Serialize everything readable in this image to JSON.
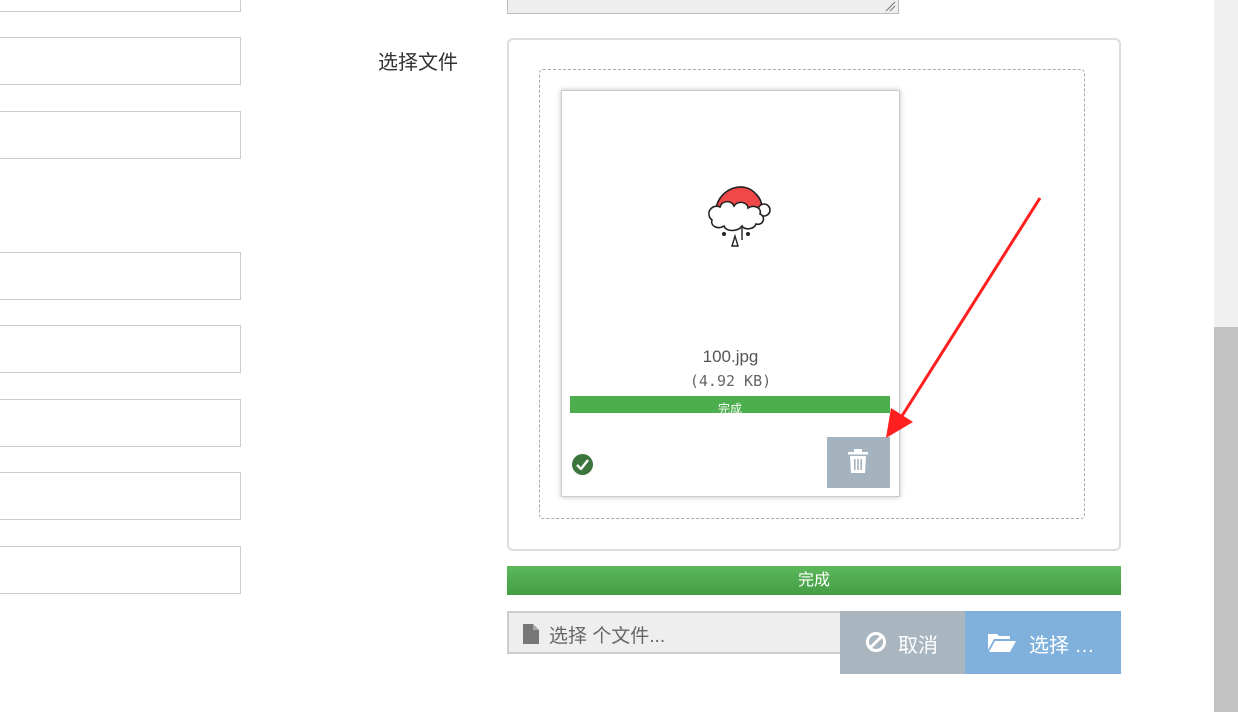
{
  "form": {
    "file_label": "选择文件"
  },
  "upload": {
    "file_name": "100.jpg",
    "file_size": "(4.92 KB)",
    "item_status": "完成",
    "item_progress": 1.0,
    "overall_status": "完成",
    "overall_progress": 1.0,
    "caption_placeholder": "选择 个文件...",
    "cancel_label": "取消",
    "browse_label": "选择 …"
  },
  "colors": {
    "progress_green": "#4cae4c",
    "success_icon": "#3c763d",
    "delete_button": "#a5b3be",
    "cancel_button": "#a9b6c0",
    "browse_button": "#7fb1dc",
    "annotation_arrow": "#ff1f1f"
  },
  "icons": {
    "success": "check-circle-icon",
    "delete": "trash-icon",
    "caption": "file-icon",
    "cancel": "ban-icon",
    "browse": "folder-open-icon"
  }
}
